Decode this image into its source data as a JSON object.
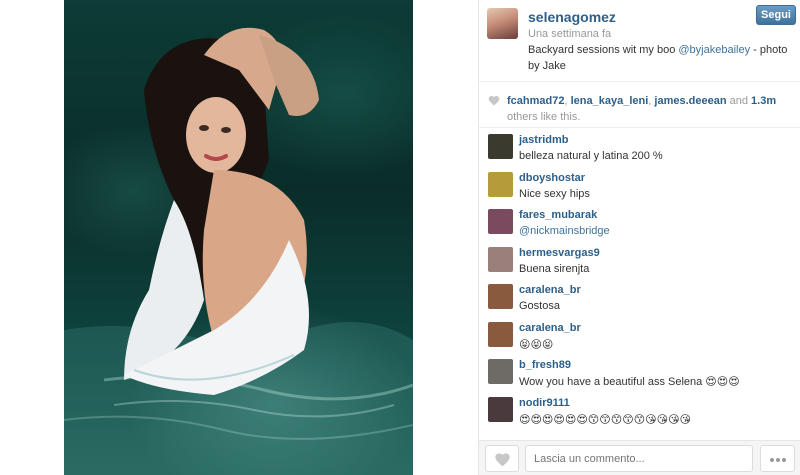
{
  "post": {
    "username": "selenagomez",
    "time": "Una settimana fa",
    "caption_text": "Backyard sessions wit my boo ",
    "caption_mention": "@byjakebailey",
    "caption_suffix": " - photo by Jake",
    "follow_label": "Segui"
  },
  "likes": {
    "users": [
      "fcahmad72",
      "lena_kaya_leni",
      "james.deeean"
    ],
    "sep1": ", ",
    "sep2": ", ",
    "and_text": " and ",
    "count": "1.3m",
    "suffix": "others like this."
  },
  "comments": [
    {
      "user": "jastridmb",
      "text": "belleza natural y latina 200 %",
      "avatar_color": "#3a3a2e"
    },
    {
      "user": "dboyshostar",
      "text": "Nice sexy hips",
      "avatar_color": "#b59b3a"
    },
    {
      "user": "fares_mubarak",
      "text": "@nickmainsbridge",
      "link": true,
      "avatar_color": "#7a4a5e"
    },
    {
      "user": "hermesvargas9",
      "text": "Buena sirenjta",
      "avatar_color": "#9a7f7a"
    },
    {
      "user": "caralena_br",
      "text": "Gostosa",
      "avatar_color": "#8a5a3e"
    },
    {
      "user": "caralena_br",
      "text": "😝😝😝",
      "avatar_color": "#8a5a3e"
    },
    {
      "user": "b_fresh89",
      "text": "Wow you have a beautiful ass Selena 😍😍😍",
      "avatar_color": "#6e6a66"
    },
    {
      "user": "nodir9111",
      "text": "😍😍😍😍😍😍😙😙😙😙😙😘😘😘😘",
      "avatar_color": "#4a3a3e"
    }
  ],
  "footer": {
    "comment_placeholder": "Lascia un commento..."
  },
  "icons": {
    "heart": "heart-icon",
    "more": "more-dots-icon"
  },
  "colors": {
    "username": "#2c5f8a",
    "follow_button": "#3f729b",
    "muted": "#999999"
  }
}
